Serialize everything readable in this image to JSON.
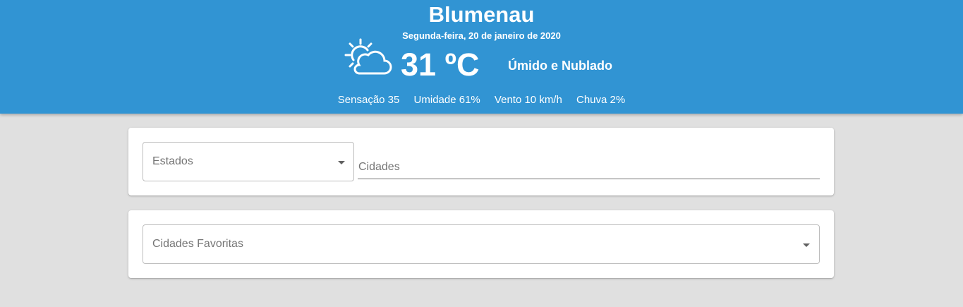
{
  "weather": {
    "city": "Blumenau",
    "date": "Segunda-feira, 20 de janeiro de 2020",
    "temperature": "31 ºC",
    "condition": "Úmido e Nublado",
    "icon": "partly-cloudy-icon",
    "stats": {
      "feels_like": "Sensação 35",
      "humidity": "Umidade 61%",
      "wind": "Vento 10 km/h",
      "rain": "Chuva 2%"
    },
    "colors": {
      "header_bg": "#3194d3",
      "page_bg": "#e0e0e0"
    }
  },
  "search": {
    "states_label": "Estados",
    "cities_placeholder": "Cidades"
  },
  "favorites": {
    "label": "Cidades Favoritas"
  }
}
